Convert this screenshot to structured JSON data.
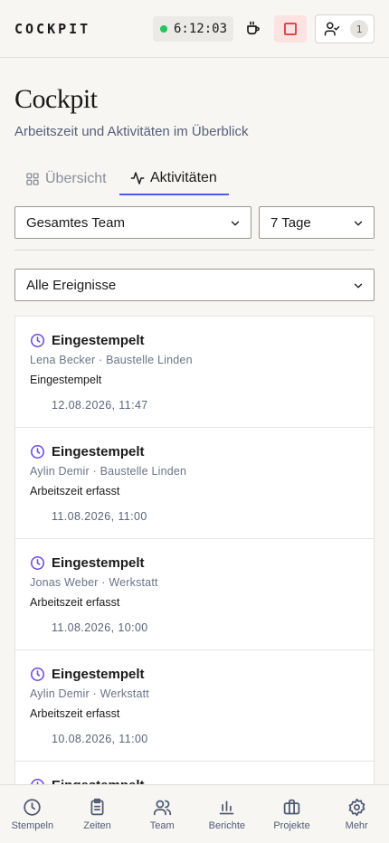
{
  "header": {
    "brand": "COCKPIT",
    "timer": "6:12:03",
    "team_count": "1"
  },
  "page": {
    "title": "Cockpit",
    "subtitle": "Arbeitszeit und Aktivitäten im Überblick"
  },
  "tabs": [
    {
      "label": "Übersicht",
      "icon": "grid-icon"
    },
    {
      "label": "Aktivitäten",
      "icon": "activity-icon",
      "active": true
    }
  ],
  "filters": {
    "team": "Gesamtes Team",
    "range": "7 Tage",
    "events": "Alle Ereignisse"
  },
  "activities": [
    {
      "title": "Eingestempelt",
      "meta": "Lena Becker · Baustelle Linden",
      "desc": "Eingestempelt",
      "time": "12.08.2026, 11:47"
    },
    {
      "title": "Eingestempelt",
      "meta": "Aylin Demir · Baustelle Linden",
      "desc": "Arbeitszeit erfasst",
      "time": "11.08.2026, 11:00"
    },
    {
      "title": "Eingestempelt",
      "meta": "Jonas Weber · Werkstatt",
      "desc": "Arbeitszeit erfasst",
      "time": "11.08.2026, 10:00"
    },
    {
      "title": "Eingestempelt",
      "meta": "Aylin Demir · Werkstatt",
      "desc": "Arbeitszeit erfasst",
      "time": "10.08.2026, 11:00"
    },
    {
      "title": "Eingestempelt"
    }
  ],
  "nav": [
    {
      "label": "Stempeln",
      "icon": "clock-icon"
    },
    {
      "label": "Zeiten",
      "icon": "clipboard-icon"
    },
    {
      "label": "Team",
      "icon": "users-icon"
    },
    {
      "label": "Berichte",
      "icon": "bar-chart-icon"
    },
    {
      "label": "Projekte",
      "icon": "briefcase-icon"
    },
    {
      "label": "Mehr",
      "icon": "gear-icon"
    }
  ],
  "colors": {
    "accent": "#4b5ce6",
    "running": "#22c55e",
    "stop": "#e0484f"
  }
}
